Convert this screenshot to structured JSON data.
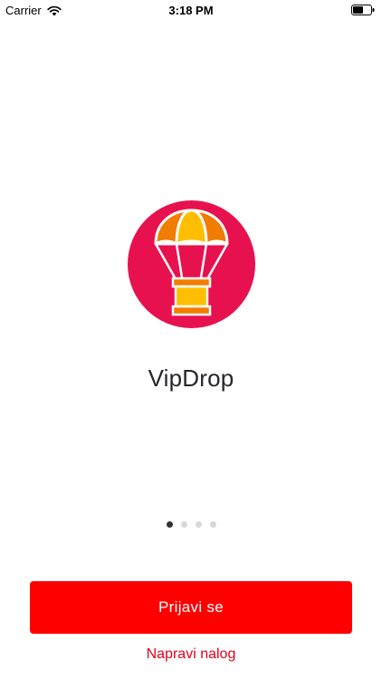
{
  "status_bar": {
    "carrier": "Carrier",
    "time": "3:18 PM",
    "icons": [
      "wifi-icon",
      "battery-icon"
    ]
  },
  "logo": {
    "icon": "parachute-crate-icon",
    "background_color": "#e8114f"
  },
  "app": {
    "title": "VipDrop"
  },
  "pager": {
    "total": 4,
    "active_index": 0
  },
  "actions": {
    "login_label": "Prijavi se",
    "register_label": "Napravi nalog"
  },
  "colors": {
    "primary": "#ff0000",
    "link": "#e0001a",
    "accent_orange": "#f07d00",
    "accent_yellow": "#ffbf00"
  }
}
